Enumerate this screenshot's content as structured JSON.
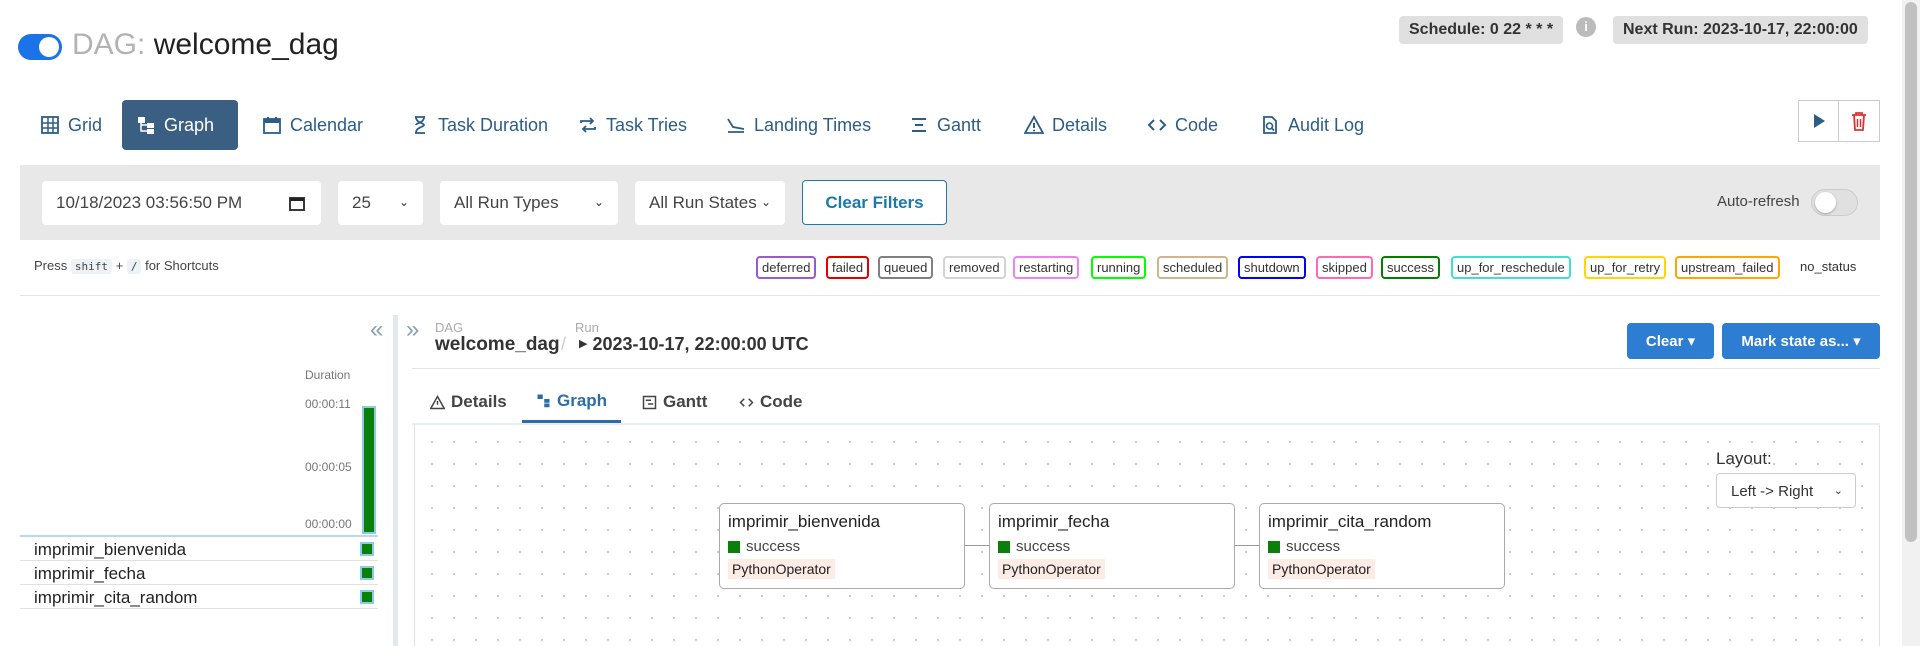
{
  "header": {
    "dag_prefix": "DAG:",
    "dag_name": "welcome_dag",
    "schedule": "Schedule: 0 22 * * *",
    "next_run": "Next Run: 2023-10-17, 22:00:00",
    "info_icon": "i"
  },
  "nav": {
    "tabs": [
      {
        "label": "Grid",
        "icon": "grid-icon"
      },
      {
        "label": "Graph",
        "icon": "graph-icon"
      },
      {
        "label": "Calendar",
        "icon": "calendar-icon"
      },
      {
        "label": "Task Duration",
        "icon": "hourglass-icon"
      },
      {
        "label": "Task Tries",
        "icon": "retry-icon"
      },
      {
        "label": "Landing Times",
        "icon": "plane-landing-icon"
      },
      {
        "label": "Gantt",
        "icon": "gantt-icon"
      },
      {
        "label": "Details",
        "icon": "warning-triangle-icon"
      },
      {
        "label": "Code",
        "icon": "code-icon"
      },
      {
        "label": "Audit Log",
        "icon": "audit-icon"
      }
    ],
    "active": "Graph"
  },
  "filters": {
    "date": "10/18/2023 03:56:50 PM",
    "num_runs": "25",
    "run_types": "All Run Types",
    "run_states": "All Run States",
    "clear_label": "Clear Filters",
    "auto_refresh": "Auto-refresh",
    "auto_refresh_on": false
  },
  "shortcuts": {
    "press": "Press",
    "key1": "shift",
    "plus": "+",
    "key2": "/",
    "suffix": "for Shortcuts"
  },
  "legend": [
    {
      "label": "deferred",
      "color": "#9b59d0"
    },
    {
      "label": "failed",
      "color": "#e00000"
    },
    {
      "label": "queued",
      "color": "#808080"
    },
    {
      "label": "removed",
      "color": "#d3d3d3"
    },
    {
      "label": "restarting",
      "color": "#ee82ee"
    },
    {
      "label": "running",
      "color": "#00ff00"
    },
    {
      "label": "scheduled",
      "color": "#d2b48c"
    },
    {
      "label": "shutdown",
      "color": "#0000ff"
    },
    {
      "label": "skipped",
      "color": "#ff69b4"
    },
    {
      "label": "success",
      "color": "#008000"
    },
    {
      "label": "up_for_reschedule",
      "color": "#40e0d0"
    },
    {
      "label": "up_for_retry",
      "color": "#ffd700"
    },
    {
      "label": "upstream_failed",
      "color": "#ffa500"
    }
  ],
  "no_status": "no_status",
  "grid": {
    "duration_label": "Duration",
    "ticks": [
      "00:00:11",
      "00:00:05",
      "00:00:00"
    ],
    "tasks": [
      "imprimir_bienvenida",
      "imprimir_fecha",
      "imprimir_cita_random"
    ]
  },
  "panel": {
    "dag_small": "DAG",
    "dag_name": "welcome_dag",
    "run_small": "Run",
    "run_value": "2023-10-17, 22:00:00 UTC",
    "clear_btn": "Clear ▾",
    "mark_btn": "Mark state as... ▾",
    "subtabs": [
      "Details",
      "Graph",
      "Gantt",
      "Code"
    ],
    "active_subtab": "Graph",
    "layout_label": "Layout:",
    "layout_value": "Left -> Right"
  },
  "nodes": [
    {
      "name": "imprimir_bienvenida",
      "status": "success",
      "operator": "PythonOperator"
    },
    {
      "name": "imprimir_fecha",
      "status": "success",
      "operator": "PythonOperator"
    },
    {
      "name": "imprimir_cita_random",
      "status": "success",
      "operator": "PythonOperator"
    }
  ]
}
